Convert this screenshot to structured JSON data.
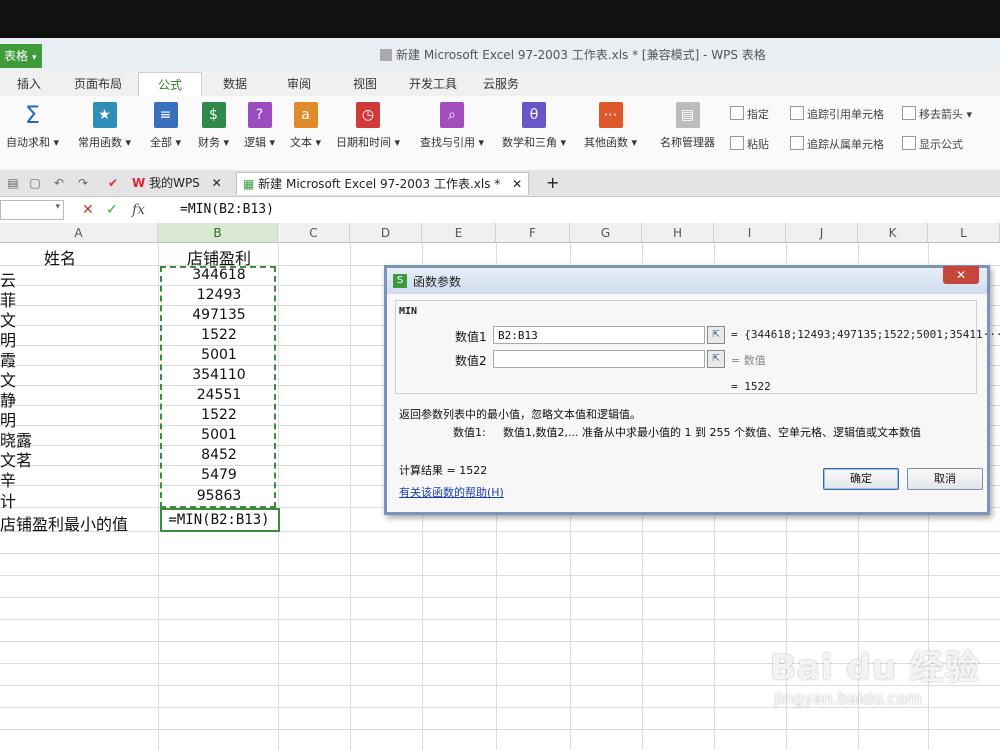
{
  "window": {
    "app_menu": "表格",
    "title": "新建 Microsoft Excel 97-2003 工作表.xls * [兼容模式] - WPS 表格"
  },
  "ribbon_tabs": [
    "插入",
    "页面布局",
    "公式",
    "数据",
    "审阅",
    "视图",
    "开发工具",
    "云服务"
  ],
  "ribbon": {
    "buttons": [
      {
        "label": "自动求和",
        "icon": "sigma-icon",
        "color": "#2a6ab8"
      },
      {
        "label": "常用函数",
        "icon": "book-star-icon",
        "color": "#2f8fb9"
      },
      {
        "label": "全部",
        "icon": "book-list-icon",
        "color": "#3a6fc0"
      },
      {
        "label": "财务",
        "icon": "book-money-icon",
        "color": "#2f8a4a"
      },
      {
        "label": "逻辑",
        "icon": "book-question-icon",
        "color": "#9b4cc0"
      },
      {
        "label": "文本",
        "icon": "book-text-icon",
        "color": "#e08a2a"
      },
      {
        "label": "日期和时间",
        "icon": "book-clock-icon",
        "color": "#d23a3a"
      },
      {
        "label": "查找与引用",
        "icon": "book-search-icon",
        "color": "#a34dbd"
      },
      {
        "label": "数学和三角",
        "icon": "book-theta-icon",
        "color": "#6b56c9"
      },
      {
        "label": "其他函数",
        "icon": "book-more-icon",
        "color": "#e0582a"
      }
    ],
    "name_manager": "名称管理器",
    "paste": "粘贴",
    "define": "指定",
    "trace_precedents": "追踪引用单元格",
    "trace_dependents": "追踪从属单元格",
    "remove_arrows": "移去箭头",
    "show_formulas": "显示公式"
  },
  "doc_tabs": {
    "my_wps": "我的WPS",
    "active_file": "新建 Microsoft Excel 97-2003 工作表.xls *",
    "add": "+"
  },
  "formula_bar": {
    "cancel": "✕",
    "accept": "✓",
    "fx": "fx",
    "formula": "=MIN(B2:B13)"
  },
  "sheet": {
    "columns": [
      "A",
      "B",
      "C",
      "D",
      "E",
      "F",
      "G",
      "H",
      "I",
      "J",
      "K",
      "L"
    ],
    "rows": [
      {
        "a": "姓名",
        "b": "店铺盈利"
      },
      {
        "a": "云",
        "b": "344618"
      },
      {
        "a": "菲",
        "b": "12493"
      },
      {
        "a": "文",
        "b": "497135"
      },
      {
        "a": "明",
        "b": "1522"
      },
      {
        "a": "霞",
        "b": "5001"
      },
      {
        "a": "文",
        "b": "354110"
      },
      {
        "a": "静",
        "b": "24551"
      },
      {
        "a": "明",
        "b": "1522"
      },
      {
        "a": "晓露",
        "b": "5001"
      },
      {
        "a": "文茗",
        "b": "8452"
      },
      {
        "a": "辛",
        "b": "5479"
      },
      {
        "a": "计",
        "b": "95863"
      },
      {
        "a": "店铺盈利最小的值",
        "b": "=MIN(B2:B13)"
      }
    ]
  },
  "dialog": {
    "title": "函数参数",
    "close": "✕",
    "function_name": "MIN",
    "arg1_label": "数值1",
    "arg1_value": "B2:B13",
    "arg1_result": "= {344618;12493;497135;1522;5001;35411···",
    "arg2_label": "数值2",
    "arg2_value": "",
    "arg2_result": "= 数值",
    "formula_result": "= 1522",
    "description": "返回参数列表中的最小值，忽略文本值和逻辑值。",
    "arg_help_label": "数值1:",
    "arg_help_text": "数值1,数值2,... 准备从中求最小值的 1 到 255 个数值、空单元格、逻辑值或文本数值",
    "calc_result": "计算结果 = 1522",
    "help_link": "有关该函数的帮助(H)",
    "ok": "确定",
    "cancel": "取消"
  },
  "watermark": {
    "brand": "Bai du 经验",
    "url": "jingyan.baidu.com"
  }
}
